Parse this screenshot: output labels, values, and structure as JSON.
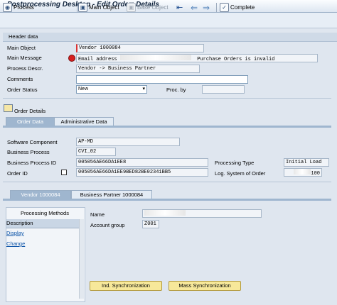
{
  "window": {
    "title": "Postprocessing Desktop - Edit Order: Details"
  },
  "toolbar": {
    "process": "Process",
    "main_object": "Main Object",
    "base_object": "Base Object",
    "complete": "Complete"
  },
  "header": {
    "section_title": "Header data",
    "main_object_label": "Main Object",
    "main_object_value": "Vendor 1000084",
    "main_message_label": "Main Message",
    "main_message_value": "Email address",
    "main_message_suffix": "Purchase Orders is invalid",
    "process_descr_label": "Process Descr.",
    "process_descr_value": "Vendor -> Business Partner",
    "comments_label": "Comments",
    "order_status_label": "Order Status",
    "order_status_value": "New",
    "proc_by_label": "Proc. by"
  },
  "order_details": {
    "title": "Order Details",
    "tabs": [
      "Order Data",
      "Administrative Data"
    ],
    "software_component_label": "Software Component",
    "software_component_value": "AP-MD",
    "business_process_label": "Business Process",
    "business_process_value": "CVI_02",
    "business_process_id_label": "Business Process ID",
    "business_process_id_value": "005056AE66DA1EE8",
    "order_id_label": "Order ID",
    "order_id_value": "005056AE66DA1EE9BED82BE02341BB5",
    "processing_type_label": "Processing Type",
    "processing_type_value": "Initial Load",
    "log_system_label": "Log. System of Order",
    "log_system_value": "100"
  },
  "object_tabs": [
    "Vendor 1000084",
    "Business Partner 1000084"
  ],
  "methods": {
    "title": "Processing Methods",
    "column": "Description",
    "items": [
      "Display",
      "Change"
    ]
  },
  "object_detail": {
    "name_label": "Name",
    "account_group_label": "Account group",
    "account_group_value": "Z001"
  },
  "buttons": {
    "ind_sync": "Ind. Synchronization",
    "mass_sync": "Mass Synchronization"
  },
  "colors": {
    "accent": "#9fb6cf",
    "button": "#f7e89a",
    "error": "#d71f1f"
  }
}
